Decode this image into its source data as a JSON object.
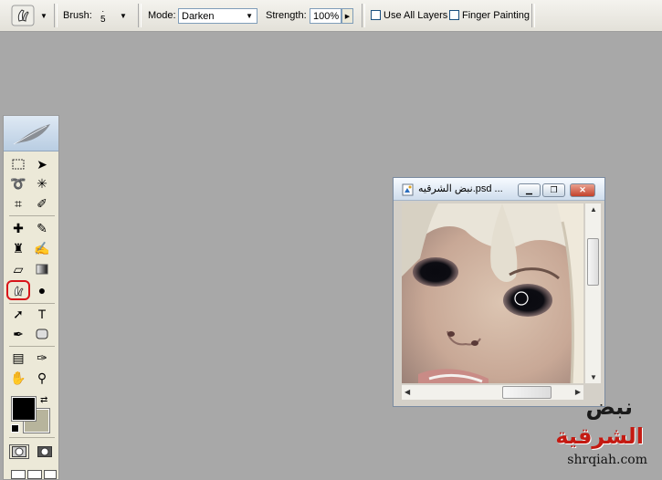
{
  "options_bar": {
    "tool_icon": "smudge-tool-icon",
    "brush_label": "Brush:",
    "brush_size": "5",
    "mode_label": "Mode:",
    "mode_value": "Darken",
    "strength_label": "Strength:",
    "strength_value": "100%",
    "use_all_layers_label": "Use All Layers",
    "finger_painting_label": "Finger Painting"
  },
  "document": {
    "title": "نبض الشرقيه.psd ..."
  },
  "colors": {
    "foreground": "#000000",
    "background": "#b7b49c"
  },
  "watermark": {
    "line1": "نبض",
    "line2": "الشرقية",
    "url": "shrqiah.com"
  }
}
